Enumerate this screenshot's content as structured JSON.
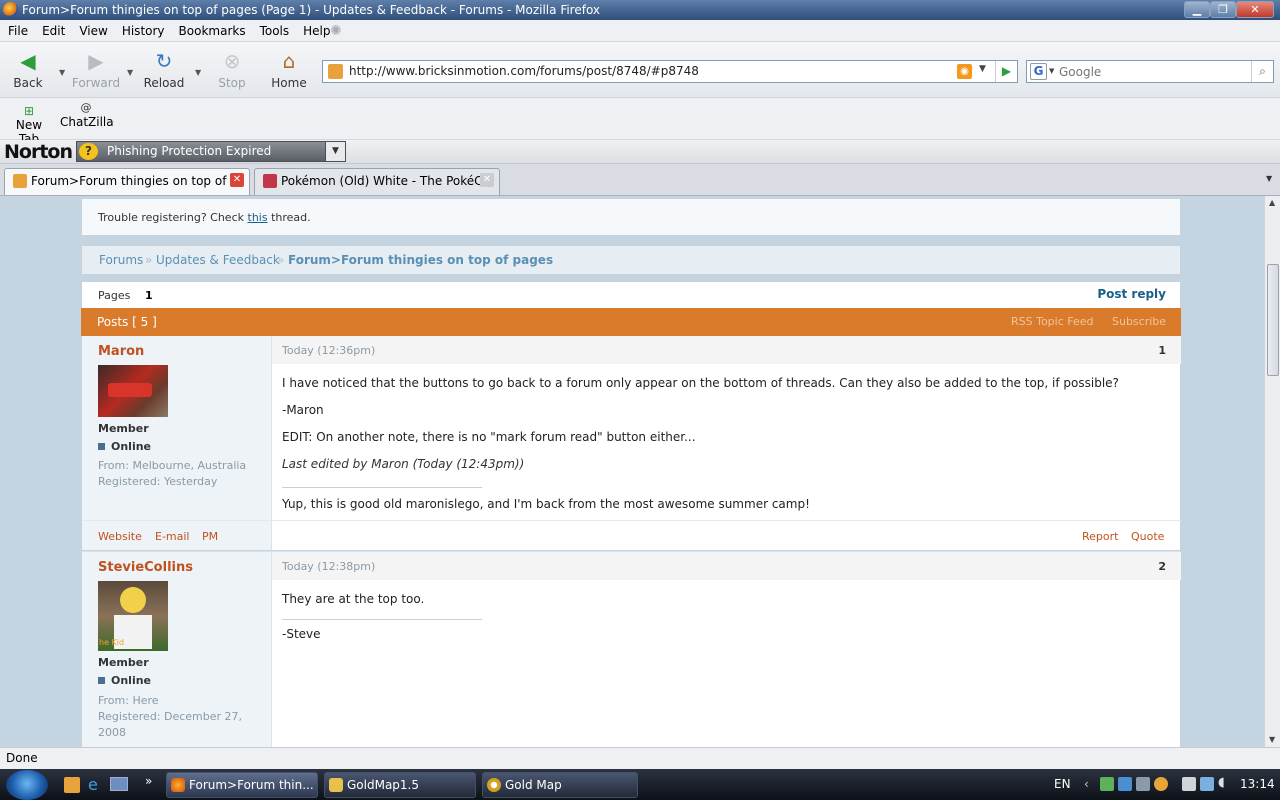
{
  "window": {
    "title": "Forum>Forum thingies on top of pages (Page 1) - Updates & Feedback - Forums - Mozilla Firefox",
    "min": "▁",
    "max": "❐",
    "close": "✕"
  },
  "menu": [
    "File",
    "Edit",
    "View",
    "History",
    "Bookmarks",
    "Tools",
    "Help"
  ],
  "nav": {
    "back": "Back",
    "forward": "Forward",
    "reload": "Reload",
    "stop": "Stop",
    "home": "Home"
  },
  "url": "http://www.bricksinmotion.com/forums/post/8748/#p8748",
  "search": {
    "engine": "G",
    "placeholder": "Google"
  },
  "bookmarks": [
    {
      "label": "New Tab"
    },
    {
      "label": "ChatZilla"
    }
  ],
  "norton": {
    "logo": "Norton",
    "status": "Phishing Protection Expired",
    "q": "?"
  },
  "tabs": [
    {
      "label": "Forum>Forum thingies on top of ..."
    },
    {
      "label": "Pokémon (Old) White - The PokéC..."
    }
  ],
  "notice": {
    "prefix": "Trouble registering? Check ",
    "link": "this",
    "suffix": " thread."
  },
  "breadcrumb": {
    "forums": "Forums",
    "sep": "»",
    "section": "Updates & Feedback",
    "topic": "Forum>Forum thingies on top of pages"
  },
  "pagination": {
    "label": "Pages",
    "current": "1",
    "post_reply": "Post reply"
  },
  "posts_header": {
    "label": "Posts [ 5 ]",
    "rss": "RSS Topic Feed",
    "subscribe": "Subscribe"
  },
  "posts": [
    {
      "author": "Maron",
      "title": "Member",
      "status": "Online",
      "from": "From: Melbourne, Australia",
      "registered": "Registered: Yesterday",
      "date": "Today (12:36pm)",
      "number": "1",
      "body": [
        "I have noticed that the buttons to go back to a forum only appear on the bottom of threads. Can they also be added to the top, if possible?",
        "-Maron",
        "EDIT: On another note, there is no \"mark forum read\" button either..."
      ],
      "edited": "Last edited by Maron (Today (12:43pm))",
      "signature": "Yup, this is good old maronislego, and I'm back from the most awesome summer camp!",
      "links": {
        "website": "Website",
        "email": "E-mail",
        "pm": "PM"
      },
      "actions": {
        "report": "Report",
        "quote": "Quote"
      }
    },
    {
      "author": "StevieCollins",
      "title": "Member",
      "status": "Online",
      "from": "From: Here",
      "registered": "Registered: December 27, 2008",
      "date": "Today (12:38pm)",
      "number": "2",
      "body": [
        "They are at the top too."
      ],
      "signature": "-Steve",
      "avatar_text": "he Kid"
    }
  ],
  "status": "Done",
  "taskbar": {
    "items": [
      "Forum>Forum thin...",
      "GoldMap1.5",
      "Gold Map"
    ],
    "lang": "EN",
    "clock": "13:14",
    "more": "»"
  },
  "colors": {
    "accent": "#d97b2a",
    "link": "#1a5f8a",
    "author": "#c0521e",
    "online": "#4a6f96"
  }
}
